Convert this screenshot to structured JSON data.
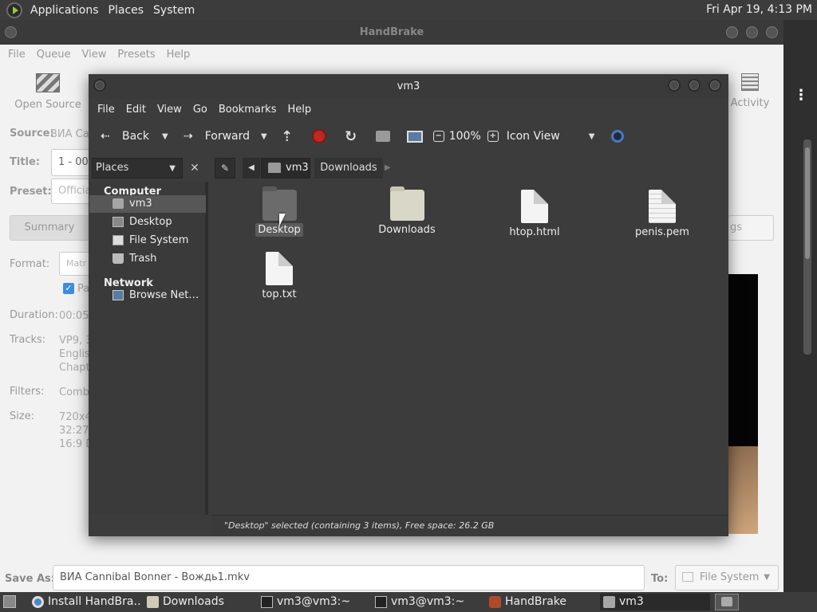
{
  "top_panel": {
    "menus": [
      "Applications",
      "Places",
      "System"
    ],
    "clock": "Fri Apr 19,  4:13 PM"
  },
  "handbrake": {
    "title": "HandBrake",
    "menus": [
      "File",
      "Queue",
      "View",
      "Presets",
      "Help"
    ],
    "open_source": "Open Source",
    "activity": "Activity",
    "source_label": "Source:",
    "source_value": "ВИА Can",
    "title_label": "Title:",
    "title_value": "1 - 00",
    "preset_label": "Preset:",
    "preset_value": "Officia",
    "summary_tab": "Summary",
    "tags_tab": "gs",
    "format_label": "Format:",
    "format_value": "Matr",
    "checkbox_label": "Pa",
    "duration_label": "Duration:",
    "duration_value": "00:05:",
    "tracks_label": "Tracks:",
    "tracks_lines": [
      "VP9, 3",
      "Englis",
      "Chapt"
    ],
    "filters_label": "Filters:",
    "filters_value": "Comb",
    "size_label": "Size:",
    "size_lines": [
      "720x4",
      "32:27",
      "16:9 D"
    ],
    "save_as_label": "Save As:",
    "save_as_value": "ВИА Cannibal Bonner - Вождь1.mkv",
    "to_label": "To:",
    "to_value": "File System"
  },
  "file_manager": {
    "title": "vm3",
    "menus": [
      "File",
      "Edit",
      "View",
      "Go",
      "Bookmarks",
      "Help"
    ],
    "toolbar": {
      "back": "Back",
      "forward": "Forward",
      "zoom": "100%",
      "view_mode": "Icon View"
    },
    "sidebar_header": "Places",
    "path": [
      "vm3",
      "Downloads"
    ],
    "sidebar": {
      "computer_heading": "Computer",
      "computer_items": [
        "vm3",
        "Desktop",
        "File System",
        "Trash"
      ],
      "network_heading": "Network",
      "network_items": [
        "Browse Net…"
      ]
    },
    "files": [
      "Desktop",
      "Downloads",
      "htop.html",
      "penis.pem",
      "top.txt"
    ],
    "status": "\"Desktop\" selected (containing 3 items), Free space: 26.2 GB"
  },
  "taskbar": {
    "tasks": [
      "Install HandBra…",
      "Downloads",
      "vm3@vm3:~",
      "vm3@vm3:~",
      "HandBrake",
      "vm3"
    ]
  }
}
